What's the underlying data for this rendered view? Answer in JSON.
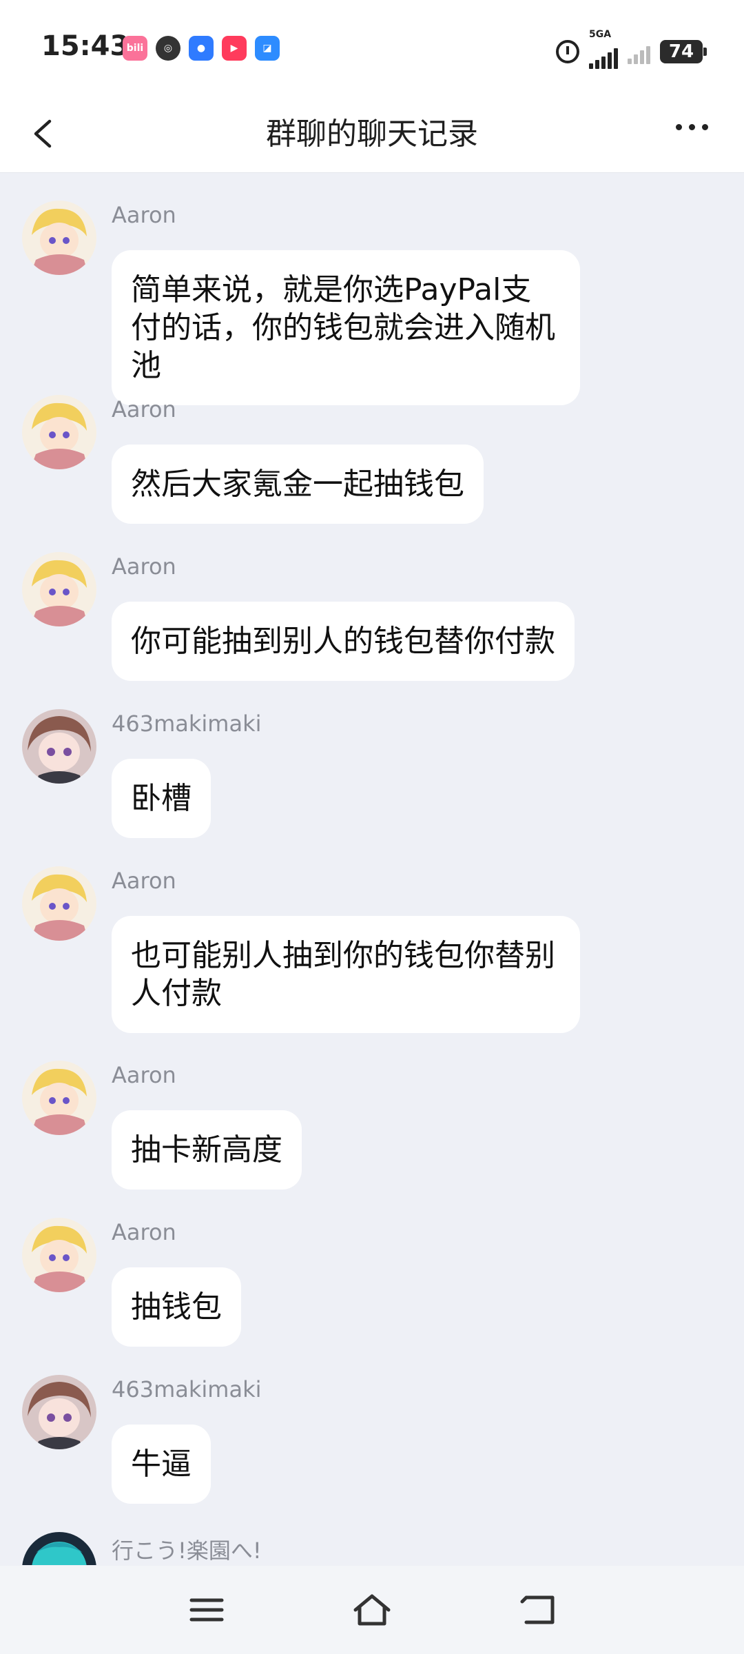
{
  "status_bar": {
    "time": "15:43",
    "network_label": "5GA",
    "battery": "74",
    "app_icons": [
      {
        "name": "bilibili-icon",
        "color": "#fb7299",
        "glyph": "b"
      },
      {
        "name": "mobile-network-icon",
        "color": "#333333",
        "glyph": "◎"
      },
      {
        "name": "assistant-app-icon",
        "color": "#2f7bff",
        "glyph": "●"
      },
      {
        "name": "video-app-icon",
        "color": "#ff3b5c",
        "glyph": "▶"
      },
      {
        "name": "browser-app-icon",
        "color": "#2d8cff",
        "glyph": "◪"
      }
    ]
  },
  "header": {
    "title": "群聊的聊天记录"
  },
  "messages": [
    {
      "sender": "Aaron",
      "text": "简单来说，就是你选PayPal支付的话，你的钱包就会进入随机池",
      "avatar": "aaron"
    },
    {
      "sender": "Aaron",
      "text": "然后大家氪金一起抽钱包",
      "avatar": "aaron"
    },
    {
      "sender": "Aaron",
      "text": "你可能抽到别人的钱包替你付款",
      "avatar": "aaron"
    },
    {
      "sender": "463makimaki",
      "text": "卧槽",
      "avatar": "maki"
    },
    {
      "sender": "Aaron",
      "text": "也可能别人抽到你的钱包你替别人付款",
      "avatar": "aaron"
    },
    {
      "sender": "Aaron",
      "text": "抽卡新高度",
      "avatar": "aaron"
    },
    {
      "sender": "Aaron",
      "text": "抽钱包",
      "avatar": "aaron"
    },
    {
      "sender": "463makimaki",
      "text": "牛逼",
      "avatar": "maki"
    },
    {
      "sender": "行こう!楽園へ!",
      "text": "",
      "avatar": "teal"
    }
  ],
  "colors": {
    "background": "#eef0f6",
    "bubble": "#ffffff",
    "sender_text": "#8a8d96"
  }
}
